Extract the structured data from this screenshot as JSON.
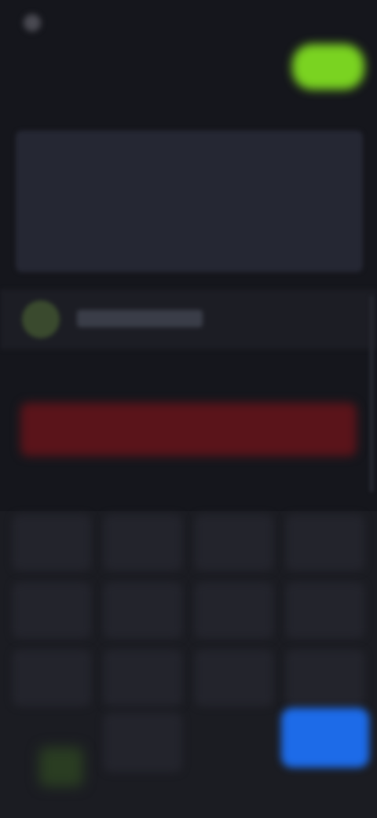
{
  "status_bar": {
    "app_name": "",
    "icons": ""
  },
  "header": {
    "title": "",
    "subtitle": "",
    "go_button": ""
  },
  "account": {
    "label": ""
  },
  "danger_button": "",
  "keypad": {
    "keys": [
      "",
      "",
      "",
      "",
      "",
      "",
      "",
      "",
      "",
      "",
      "",
      "",
      "",
      "",
      ""
    ],
    "action_label": ""
  },
  "colors": {
    "background": "#15161c",
    "panel": "#252733",
    "accent_green": "#7ad321",
    "danger_red": "#5a141a",
    "action_blue": "#1d6be8"
  }
}
